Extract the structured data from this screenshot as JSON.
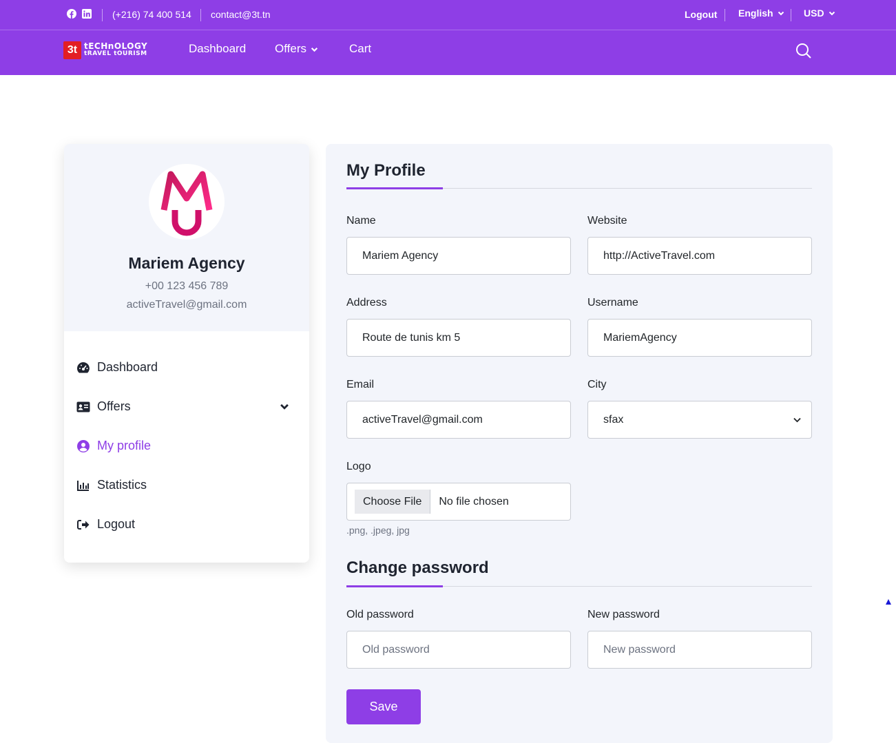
{
  "topbar": {
    "phone": "(+216) 74 400 514",
    "email": "contact@3t.tn",
    "logout": "Logout",
    "language": "English",
    "currency": "USD",
    "social_icons": [
      "facebook-icon",
      "linkedin-icon"
    ]
  },
  "nav": {
    "logo_top": "tECHnOLOGY",
    "logo_bottom": "tRAVEL tOURISM",
    "logo_mark": "3t",
    "links": [
      "Dashboard",
      "Offers",
      "Cart"
    ]
  },
  "profile_card": {
    "name": "Mariem Agency",
    "phone": "+00 123 456 789",
    "email": "activeTravel@gmail.com",
    "avatar_letters": "MU"
  },
  "sidebar_menu": [
    {
      "label": "Dashboard",
      "icon": "gauge-icon"
    },
    {
      "label": "Offers",
      "icon": "id-card-icon"
    },
    {
      "label": "My profile",
      "icon": "user-circle-icon"
    },
    {
      "label": "Statistics",
      "icon": "bar-chart-icon"
    },
    {
      "label": "Logout",
      "icon": "logout-icon"
    }
  ],
  "form": {
    "title": "My Profile",
    "name_label": "Name",
    "name_value": "Mariem Agency",
    "website_label": "Website",
    "website_value": "http://ActiveTravel.com",
    "address_label": "Address",
    "address_value": "Route de tunis km 5",
    "username_label": "Username",
    "username_value": "MariemAgency",
    "email_label": "Email",
    "email_value": "activeTravel@gmail.com",
    "city_label": "City",
    "city_value": "sfax",
    "logo_label": "Logo",
    "file_button": "Choose File",
    "file_status": "No file chosen",
    "file_hint": ".png, .jpeg, jpg"
  },
  "password": {
    "title": "Change password",
    "old_label": "Old password",
    "old_placeholder": "Old password",
    "new_label": "New password",
    "new_placeholder": "New password",
    "save": "Save"
  },
  "colors": {
    "accent": "#8e3ee6",
    "card_bg": "#f3f5fb"
  }
}
